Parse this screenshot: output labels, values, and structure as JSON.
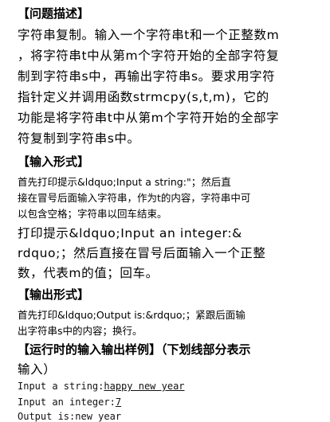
{
  "sections": {
    "problem_heading": "【问题描述】",
    "problem_lines": [
      "字符串复制。输入一个字符串t和一个正整数m",
      "，将字符串t中从第m个字符开始的全部字符复",
      "制到字符串s中，再输出字符串s。要求用字符",
      "指针定义并调用函数strmcpy(s,t,m)，它的",
      "功能是将字符串t中从第m个字符开始的全部字",
      "符复制到字符串s中。"
    ],
    "input_heading": "【输入形式】",
    "input_lines": [
      "首先打印提示&ldquo;Input a string:\"；然后直",
      "接在冒号后面输入字符串，作为t的内容，字符串中可",
      "以包含空格；字符串以回车结束。"
    ],
    "input_lines2": [
      "    打印提示&ldquo;Input an integer:&",
      "rdquo;；然后直接在冒号后面输入一个正整",
      "数，代表m的值；回车。"
    ],
    "output_heading": "【输出形式】",
    "output_lines": [
      "首先打印&ldquo;Output is:&rdquo;；紧跟后面输",
      "出字符串s中的内容；换行。"
    ],
    "sample_heading": "【运行时的输入输出样例】（下划线部分表示",
    "sample_heading2": "输入）",
    "sample": {
      "line1_prompt": "Input a string:",
      "line1_input": "happy new year",
      "line2_prompt": "Input an integer:",
      "line2_input": "7",
      "line3": "Output is:new year"
    }
  }
}
